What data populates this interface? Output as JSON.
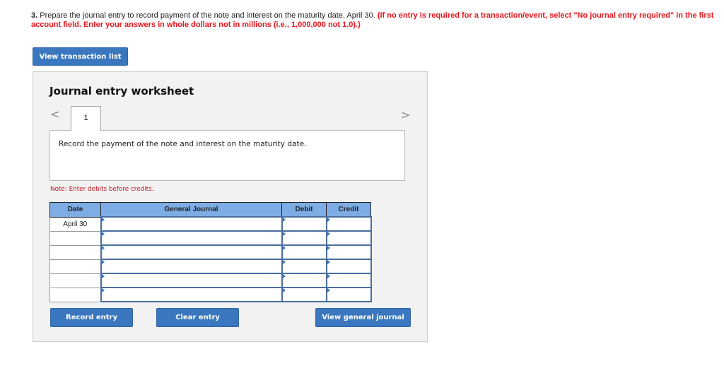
{
  "question": {
    "number": "3.",
    "text": " Prepare the journal entry to record payment of the note and interest on the maturity date, April 30. ",
    "instruction": "(If no entry is required for a transaction/event, select \"No journal entry required\" in the first account field. Enter your answers in whole dollars not in millions (i.e., 1,000,000 not 1.0).)"
  },
  "buttons": {
    "view_transaction_list": "View transaction list",
    "record_entry": "Record entry",
    "clear_entry": "Clear entry",
    "view_general_journal": "View general journal"
  },
  "worksheet": {
    "title": "Journal entry worksheet",
    "prev_icon": "chevron-left-icon",
    "next_icon": "chevron-right-icon",
    "prev_glyph": "<",
    "next_glyph": ">",
    "active_tab": "1",
    "description": "Record the payment of the note and interest on the maturity date.",
    "note": "Note: Enter debits before credits."
  },
  "table": {
    "headers": {
      "date": "Date",
      "account": "General Journal",
      "debit": "Debit",
      "credit": "Credit"
    },
    "rows": [
      {
        "date": "April 30",
        "account": "",
        "debit": "",
        "credit": ""
      },
      {
        "date": "",
        "account": "",
        "debit": "",
        "credit": ""
      },
      {
        "date": "",
        "account": "",
        "debit": "",
        "credit": ""
      },
      {
        "date": "",
        "account": "",
        "debit": "",
        "credit": ""
      },
      {
        "date": "",
        "account": "",
        "debit": "",
        "credit": ""
      },
      {
        "date": "",
        "account": "",
        "debit": "",
        "credit": ""
      }
    ]
  },
  "colors": {
    "accent_button": "#3b77be",
    "instruction_red": "#e8141b",
    "note_red": "#c0141b",
    "header_blue": "#7dade4",
    "panel_bg": "#f2f2f2"
  }
}
